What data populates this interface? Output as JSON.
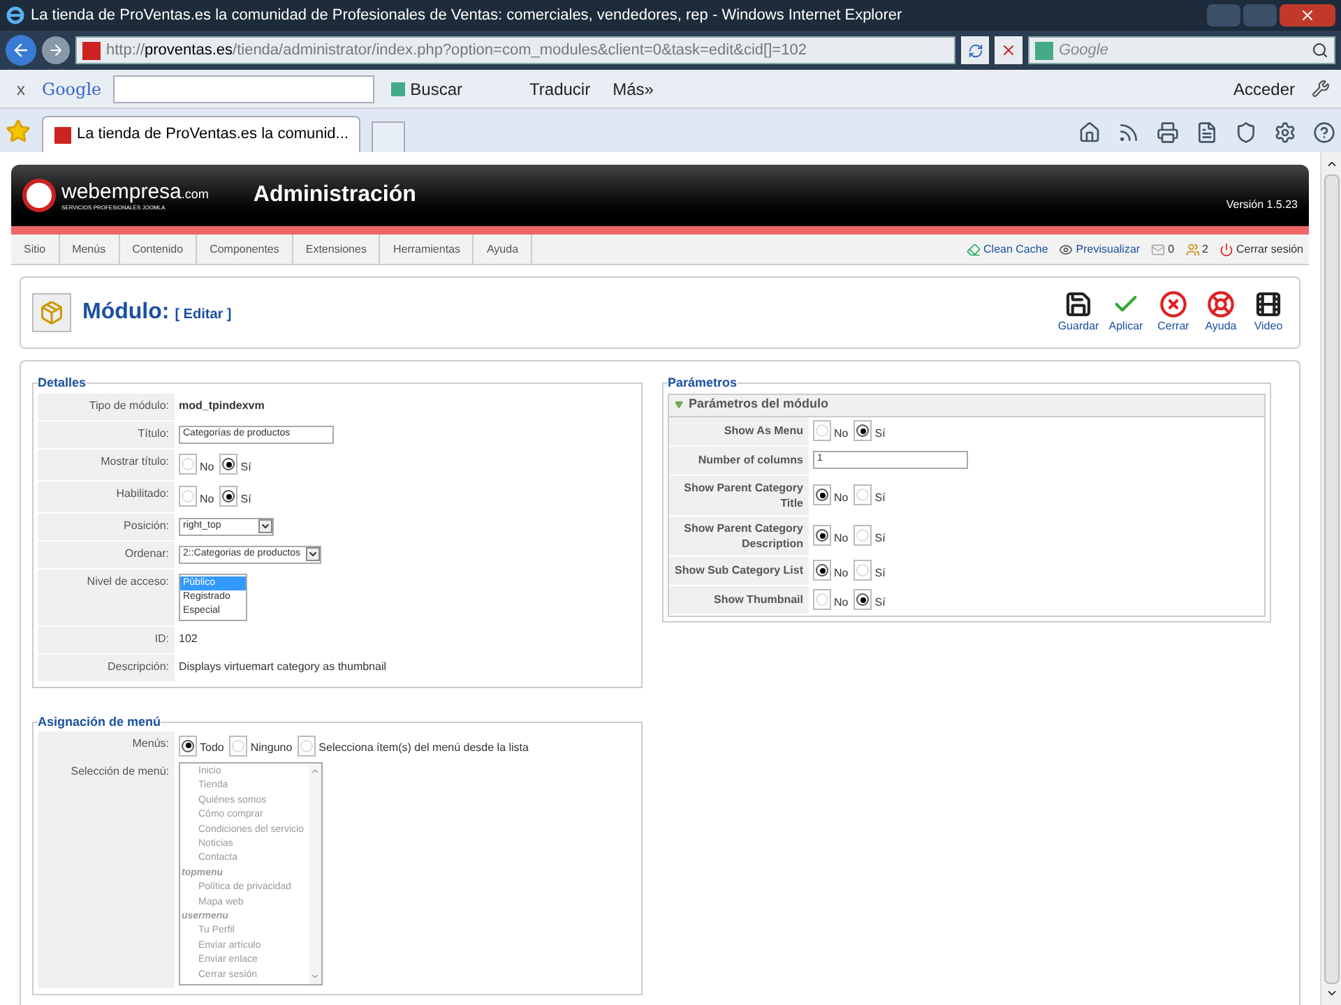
{
  "window": {
    "title": "La tienda de ProVentas.es la comunidad de Profesionales de Ventas: comerciales, vendedores, rep - Windows Internet Explorer"
  },
  "address_bar": {
    "url_prefix": "http://",
    "url_host": "proventas.es",
    "url_path": "/tienda/administrator/index.php?option=com_modules&client=0&task=edit&cid[]=102",
    "search_placeholder": "Google"
  },
  "google_toolbar": {
    "close": "x",
    "logo": "Google",
    "search_button": "Buscar",
    "translate": "Traducir",
    "more": "Más",
    "more_arrows": "»",
    "sign_in": "Acceder"
  },
  "tabs": [
    {
      "label": "La tienda de ProVentas.es la comunid...",
      "selected": true
    }
  ],
  "admin_header": {
    "logo": "webempresa",
    "logo_suffix": ".com",
    "logo_tagline": "SERVICIOS PROFESIONALES JOOMLA",
    "title": "Administración",
    "version": "Versión 1.5.23"
  },
  "menu_bar": [
    "Sitio",
    "Menús",
    "Contenido",
    "Componentes",
    "Extensiones",
    "Herramientas",
    "Ayuda"
  ],
  "status_links": [
    {
      "kind": "clean",
      "label": "Clean Cache"
    },
    {
      "kind": "preview",
      "label": "Previsualizar"
    },
    {
      "kind": "messages",
      "label": "0"
    },
    {
      "kind": "users",
      "label": "2"
    },
    {
      "kind": "logout",
      "label": "Cerrar sesión"
    }
  ],
  "page_title": {
    "title": "Módulo:",
    "subtitle": "[ Editar ]"
  },
  "toolbar": [
    {
      "kind": "save",
      "label": "Guardar"
    },
    {
      "kind": "apply",
      "label": "Aplicar"
    },
    {
      "kind": "close",
      "label": "Cerrar"
    },
    {
      "kind": "help",
      "label": "Ayuda"
    },
    {
      "kind": "video",
      "label": "Video"
    }
  ],
  "details": {
    "legend": "Detalles",
    "rows": [
      {
        "label": "Tipo de módulo:",
        "kind": "strong",
        "value": "mod_tpindexvm"
      },
      {
        "label": "Título:",
        "kind": "input",
        "value": "Categorías de productos"
      },
      {
        "label": "Mostrar título:",
        "kind": "radio",
        "options": [
          {
            "label": "No",
            "selected": false
          },
          {
            "label": "Sí",
            "selected": true
          }
        ]
      },
      {
        "label": "Habilitado:",
        "kind": "radio",
        "options": [
          {
            "label": "No",
            "selected": false
          },
          {
            "label": "Sí",
            "selected": true
          }
        ]
      },
      {
        "label": "Posición:",
        "kind": "select",
        "value": "right_top"
      },
      {
        "label": "Ordenar:",
        "kind": "select",
        "value": "2::Categorias de productos"
      },
      {
        "label": "Nivel de acceso:",
        "kind": "listbox",
        "options": [
          {
            "label": "Público",
            "selected": true
          },
          {
            "label": "Registrado",
            "selected": false
          },
          {
            "label": "Especial",
            "selected": false
          }
        ]
      },
      {
        "label": "ID:",
        "kind": "text",
        "value": "102"
      },
      {
        "label": "Descripción:",
        "kind": "text",
        "value": "Displays virtuemart category as thumbnail"
      }
    ]
  },
  "menu_assignment": {
    "legend": "Asignación de menú",
    "menus_label": "Menús:",
    "menus": [
      {
        "label": "Todo",
        "selected": true
      },
      {
        "label": "Ninguno",
        "selected": false
      },
      {
        "label": "Selecciona ítem(s) del menú desde la lista",
        "selected": false
      }
    ],
    "selection_label": "Selección de menú:",
    "disabled": true,
    "groups": [
      {
        "children": [
          "Inicio",
          "Tienda",
          "Quiénes somos",
          "Cómo comprar",
          "Condiciones del servicio",
          "Noticias",
          "Contacta"
        ]
      },
      {
        "label": "topmenu",
        "children": [
          "Política de privacidad",
          "Mapa web"
        ]
      },
      {
        "label": "usermenu",
        "children": [
          "Tu Perfil",
          "Enviar artículo",
          "Enviar enlace",
          "Cerrar sesión"
        ]
      }
    ]
  },
  "parameters": {
    "legend": "Parámetros",
    "panel_title": "Parámetros del módulo",
    "expanded": true,
    "rows": [
      {
        "label": "Show As Menu",
        "kind": "radio",
        "options": [
          {
            "label": "No",
            "selected": false
          },
          {
            "label": "Sí",
            "selected": true
          }
        ]
      },
      {
        "label": "Number of columns",
        "kind": "input",
        "value": "1"
      },
      {
        "label": "Show Parent Category Title",
        "kind": "radio",
        "options": [
          {
            "label": "No",
            "selected": true
          },
          {
            "label": "Sí",
            "selected": false
          }
        ]
      },
      {
        "label": "Show Parent Category Description",
        "kind": "radio",
        "options": [
          {
            "label": "No",
            "selected": true
          },
          {
            "label": "Sí",
            "selected": false
          }
        ]
      },
      {
        "label": "Show Sub Category List",
        "kind": "radio",
        "options": [
          {
            "label": "No",
            "selected": true
          },
          {
            "label": "Sí",
            "selected": false
          }
        ]
      },
      {
        "label": "Show Thumbnail",
        "kind": "radio",
        "options": [
          {
            "label": "No",
            "selected": false
          },
          {
            "label": "Sí",
            "selected": true
          }
        ]
      }
    ]
  }
}
